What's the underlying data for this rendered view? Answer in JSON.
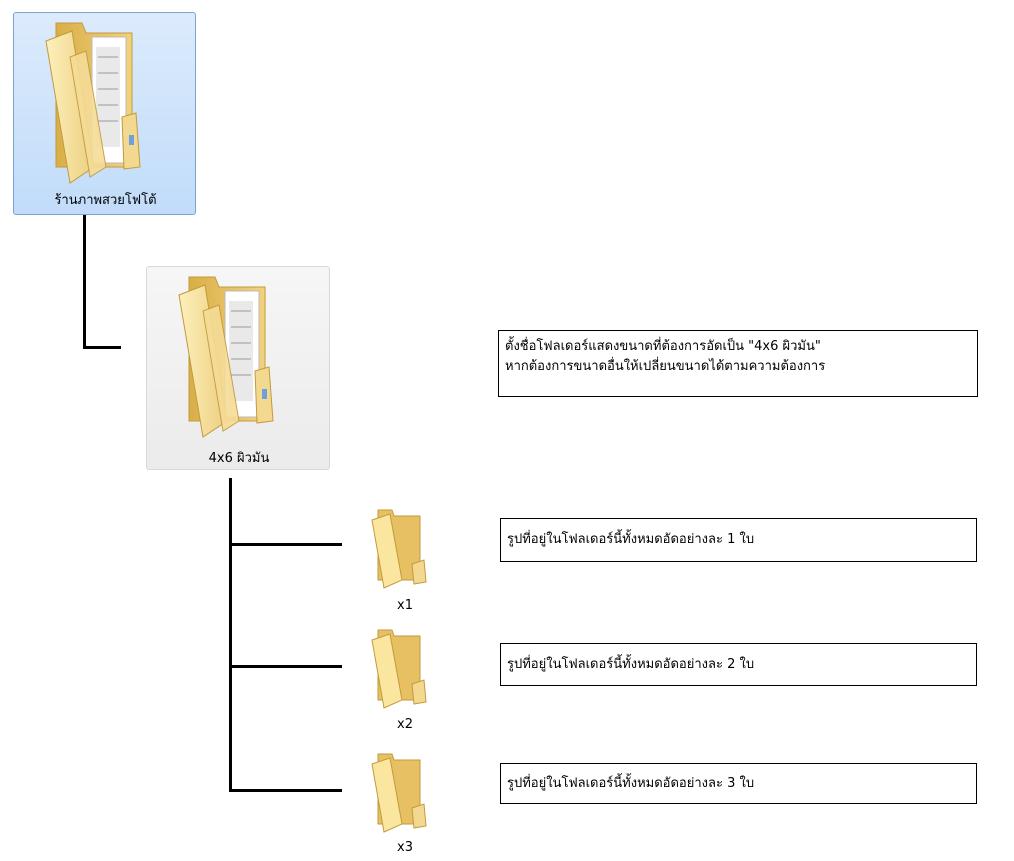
{
  "root_folder": {
    "label": "ร้านภาพสวยโฟโต้",
    "icon": "folder-icon"
  },
  "size_folder": {
    "label": "4x6 ผิวมัน",
    "icon": "folder-icon"
  },
  "size_note": {
    "line1": "ตั้งชื่อโฟลเดอร์แสดงขนาดที่ต้องการอัดเป็น \"4x6 ผิวมัน\"",
    "line2": "หากต้องการขนาดอื่นให้เปลี่ยนขนาดได้ตามความต้องการ"
  },
  "copies": [
    {
      "label": "x1",
      "note": "รูปที่อยู่ในโฟลเดอร์นี้ทั้งหมดอัดอย่างละ 1 ใบ"
    },
    {
      "label": "x2",
      "note": "รูปที่อยู่ในโฟลเดอร์นี้ทั้งหมดอัดอย่างละ 2 ใบ"
    },
    {
      "label": "x3",
      "note": "รูปที่อยู่ในโฟลเดอร์นี้ทั้งหมดอัดอย่างละ 3 ใบ"
    }
  ],
  "colors": {
    "folder_light": "#fbe7a1",
    "folder_dark": "#e2bd5a",
    "selection": "#c9e0fb",
    "connector": "#000000"
  }
}
